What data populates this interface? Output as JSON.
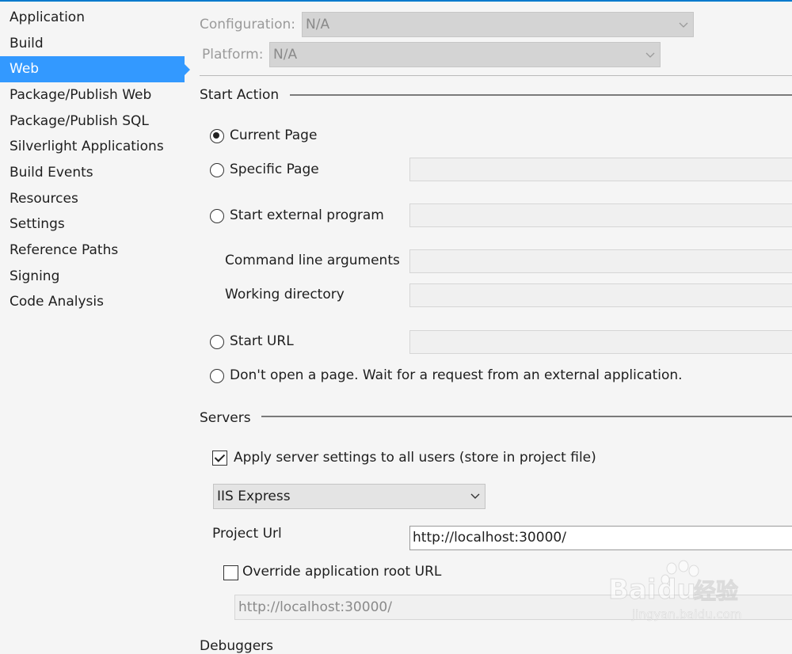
{
  "sidebar": {
    "items": [
      {
        "label": "Application"
      },
      {
        "label": "Build"
      },
      {
        "label": "Web",
        "selected": true
      },
      {
        "label": "Package/Publish Web"
      },
      {
        "label": "Package/Publish SQL"
      },
      {
        "label": "Silverlight Applications"
      },
      {
        "label": "Build Events"
      },
      {
        "label": "Resources"
      },
      {
        "label": "Settings"
      },
      {
        "label": "Reference Paths"
      },
      {
        "label": "Signing"
      },
      {
        "label": "Code Analysis"
      }
    ]
  },
  "config": {
    "configuration_label": "Configuration:",
    "configuration_value": "N/A",
    "platform_label": "Platform:",
    "platform_value": "N/A"
  },
  "start_action": {
    "title": "Start Action",
    "current_page": "Current Page",
    "specific_page": "Specific Page",
    "external_program": "Start external program",
    "command_line_args": "Command line arguments",
    "working_directory": "Working directory",
    "start_url": "Start URL",
    "dont_open": "Don't open a page.  Wait for a request from an external application.",
    "selected": "current_page"
  },
  "servers": {
    "title": "Servers",
    "apply_all_label": "Apply server settings to all users (store in project file)",
    "apply_all_checked": true,
    "server_value": "IIS Express",
    "project_url_label": "Project Url",
    "project_url_value": "http://localhost:30000/",
    "override_label": "Override application root URL",
    "override_checked": false,
    "override_value": "http://localhost:30000/"
  },
  "next_section_title": "Debuggers",
  "watermark": {
    "brand": "Bai",
    "brand2": "du",
    "jingyan": "经验",
    "url": "jingyan.baidu.com"
  },
  "colors": {
    "accent": "#3399ff",
    "topline": "#007acc"
  }
}
